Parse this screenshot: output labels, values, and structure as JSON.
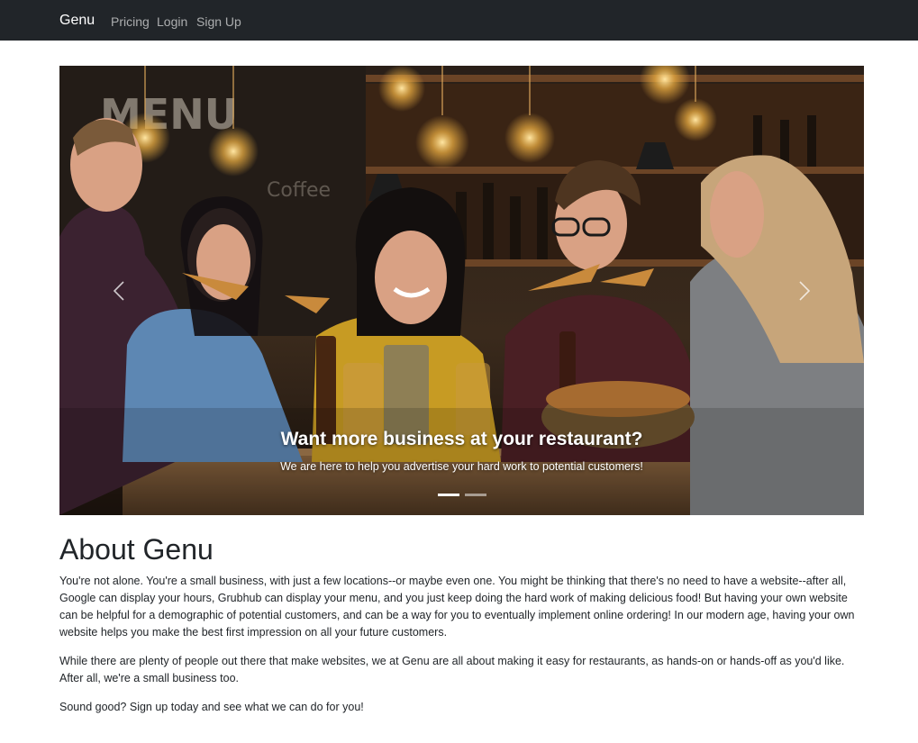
{
  "navbar": {
    "brand": "Genu",
    "links": [
      "Pricing",
      "Login",
      "Sign Up"
    ]
  },
  "carousel": {
    "image_icon": "restaurant-photo",
    "prev_icon": "chevron-left-icon",
    "next_icon": "chevron-right-icon",
    "caption_title": "Want more business at your restaurant?",
    "caption_text": "We are here to help you advertise your hard work to potential customers!",
    "slide_count": 2,
    "active_slide": 1
  },
  "about": {
    "title": "About Genu",
    "paragraphs": [
      "You're not alone. You're a small business, with just a few locations--or maybe even one. You might be thinking that there's no need to have a website--after all, Google can display your hours, Grubhub can display your menu, and you just keep doing the hard work of making delicious food! But having your own website can be helpful for a demographic of potential customers, and can be a way for you to eventually implement online ordering! In our modern age, having your own website helps you make the best first impression on all your future customers.",
      "While there are plenty of people out there that make websites, we at Genu are all about making it easy for restaurants, as hands-on or hands-off as you'd like. After all, we're a small business too.",
      "Sound good? Sign up today and see what we can do for you!"
    ]
  },
  "colors": {
    "navbar_bg": "#212529",
    "text": "#212529",
    "white": "#ffffff"
  }
}
